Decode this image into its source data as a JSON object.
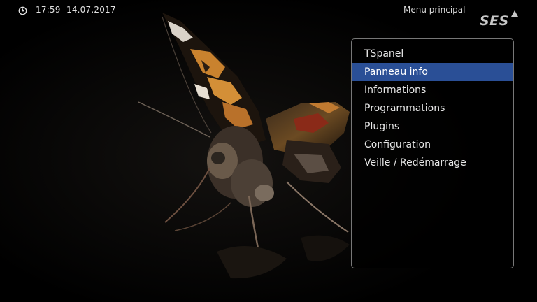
{
  "topbar": {
    "clock_icon": "clock-icon",
    "time": "17:59",
    "date": "14.07.2017",
    "screen_title": "Menu principal",
    "logo_text": "SES"
  },
  "menu": {
    "items": [
      {
        "label": "TSpanel",
        "selected": false
      },
      {
        "label": "Panneau info",
        "selected": true
      },
      {
        "label": "Informations",
        "selected": false
      },
      {
        "label": "Programmations",
        "selected": false
      },
      {
        "label": "Plugins",
        "selected": false
      },
      {
        "label": "Configuration",
        "selected": false
      },
      {
        "label": "Veille / Redémarrage",
        "selected": false
      }
    ]
  },
  "colors": {
    "selection": "#2a4f96",
    "background": "#000000",
    "panel_border": "#777777"
  },
  "background_image": "butterfly-wallpaper"
}
